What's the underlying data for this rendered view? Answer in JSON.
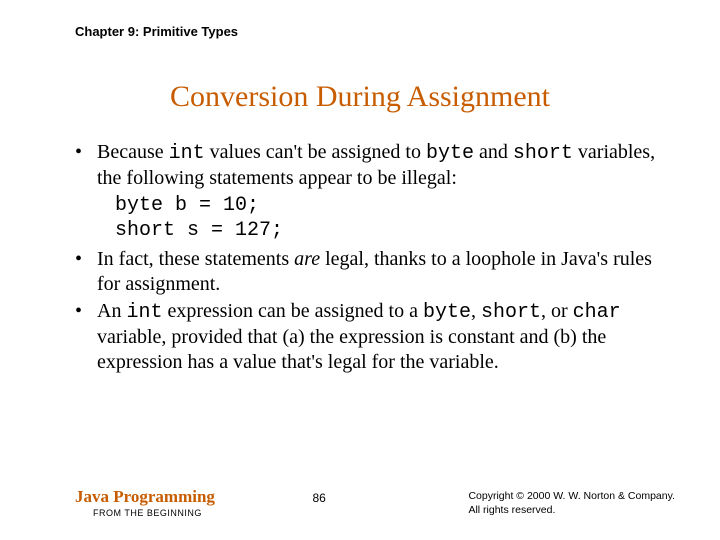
{
  "chapter": "Chapter 9: Primitive Types",
  "title": "Conversion During Assignment",
  "bullets": {
    "b1_pre": "Because ",
    "b1_c1": "int",
    "b1_mid1": " values can't be assigned to ",
    "b1_c2": "byte",
    "b1_mid2": " and ",
    "b1_c3": "short",
    "b1_post": " variables, the following statements appear to be illegal:",
    "code1": "byte b = 10;",
    "code2": "short s = 127;",
    "b2_pre": "In fact, these statements ",
    "b2_em": "are",
    "b2_post": " legal, thanks to a loophole in Java's rules for assignment.",
    "b3_pre": "An ",
    "b3_c1": "int",
    "b3_mid1": " expression can be assigned to a ",
    "b3_c2": "byte",
    "b3_mid2": ", ",
    "b3_c3": "short",
    "b3_mid3": ", or ",
    "b3_c4": "char",
    "b3_post": " variable, provided that (a) the expression is constant and (b) the expression has a value that's legal for the variable."
  },
  "footer": {
    "brand": "Java Programming",
    "tagline": "FROM THE BEGINNING",
    "page": "86",
    "copyright1": "Copyright © 2000 W. W. Norton & Company.",
    "copyright2": "All rights reserved."
  }
}
